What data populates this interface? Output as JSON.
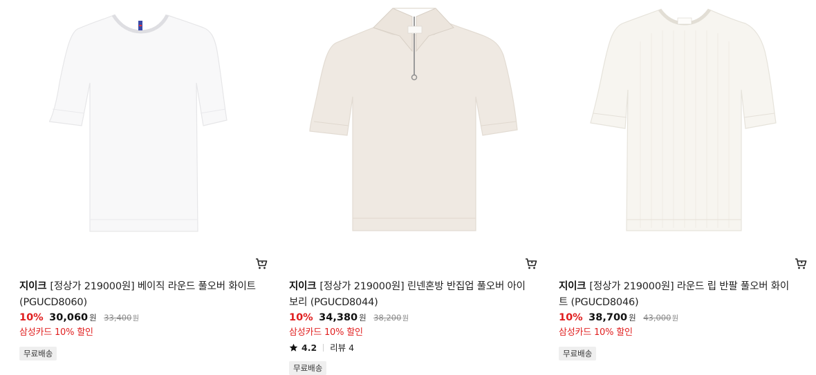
{
  "products": [
    {
      "brand": "지이크",
      "name": "[정상가 219000원] 베이직 라운드 풀오버 화이트 (PGUCD8060)",
      "discount": "10%",
      "price": "30,060",
      "price_unit": "원",
      "original_price": "33,400",
      "original_unit": "원",
      "promo": "삼성카드 10% 할인",
      "badge": "무료배송",
      "image_icon": "knit-tshirt-white",
      "cart_icon": "cart-icon"
    },
    {
      "brand": "지이크",
      "name": "[정상가 219000원] 린넨혼방 반집업 풀오버 아이보리 (PGUCD8044)",
      "discount": "10%",
      "price": "34,380",
      "price_unit": "원",
      "original_price": "38,200",
      "original_unit": "원",
      "promo": "삼성카드 10% 할인",
      "rating": "4.2",
      "review_label": "리뷰 4",
      "badge": "무료배송",
      "image_icon": "half-zip-knit-ivory",
      "cart_icon": "cart-icon"
    },
    {
      "brand": "지이크",
      "name": "[정상가 219000원] 라운드 립 반팔 풀오버 화이트 (PGUCD8046)",
      "discount": "10%",
      "price": "38,700",
      "price_unit": "원",
      "original_price": "43,000",
      "original_unit": "원",
      "promo": "삼성카드 10% 할인",
      "badge": "무료배송",
      "image_icon": "rib-knit-tshirt-cream",
      "cart_icon": "cart-icon"
    }
  ],
  "colors": {
    "discount": "#e01e1e",
    "badge_bg": "#efefef",
    "text": "#222222",
    "muted": "#888888"
  }
}
